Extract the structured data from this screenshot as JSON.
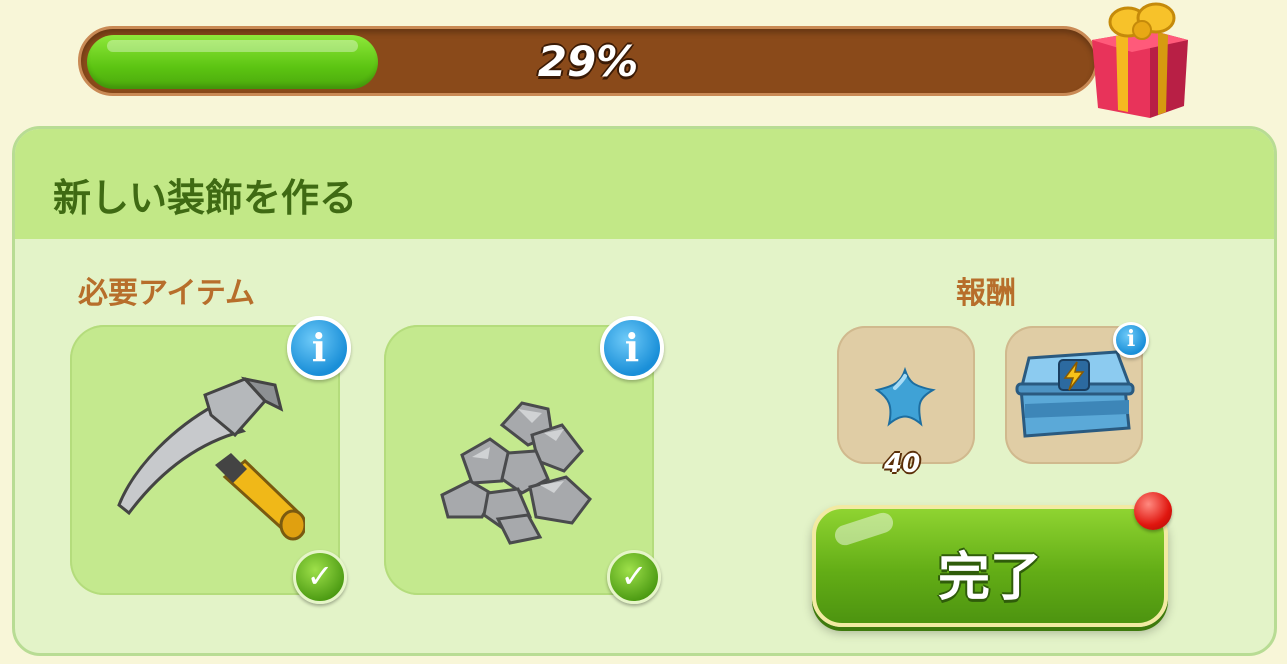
{
  "progress": {
    "label": "29%",
    "value": 0.29
  },
  "quest": {
    "title": "新しい装飾を作る"
  },
  "requirements": {
    "label": "必要アイテム",
    "items": [
      {
        "icon": "hammer-icon",
        "status": "complete"
      },
      {
        "icon": "stones-icon",
        "status": "complete"
      }
    ]
  },
  "rewards": {
    "label": "報酬",
    "items": [
      {
        "icon": "blue-star-icon",
        "count": "40"
      },
      {
        "icon": "energy-chest-icon"
      }
    ]
  },
  "actions": {
    "complete_label": "完了"
  },
  "colors": {
    "progress_fill": "#5cc412",
    "progress_track": "#8a4a1a",
    "button": "#63ad16"
  }
}
